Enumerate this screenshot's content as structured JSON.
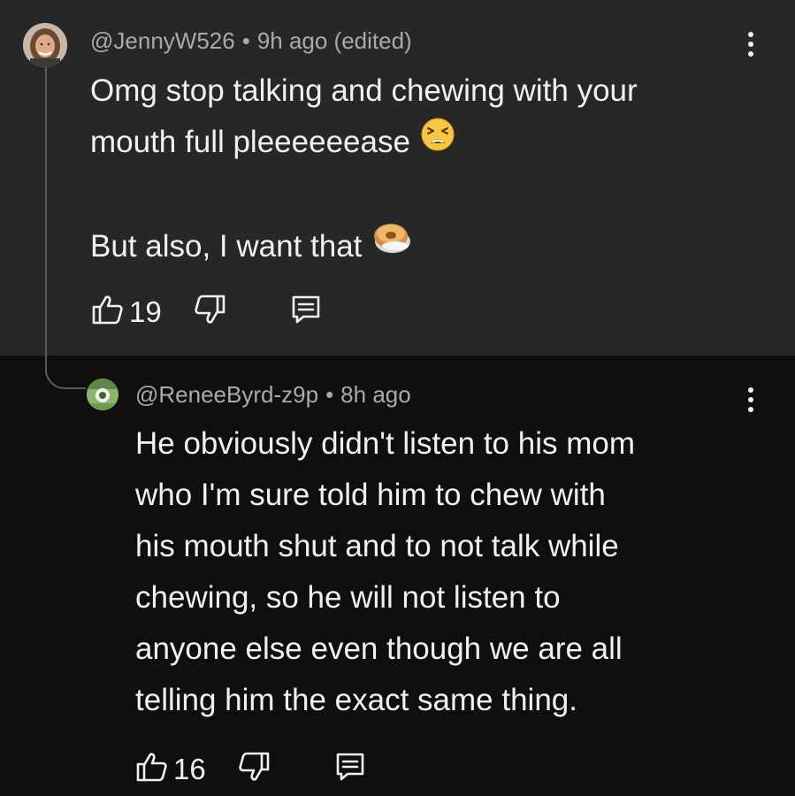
{
  "comments": [
    {
      "author": "@JennyW526",
      "separator": "•",
      "time": "9h ago (edited)",
      "lines": [
        "Omg stop talking and chewing with your",
        "mouth full pleeeeeease",
        "",
        "But also, I want that"
      ],
      "likes": "19",
      "emojis": [
        "tired-face",
        "bagel"
      ]
    },
    {
      "author": "@ReneeByrd-z9p",
      "separator": "•",
      "time": "8h ago",
      "lines": [
        "He obviously didn't listen to his mom",
        "who I'm sure told him to chew with",
        "his mouth shut and to not talk while",
        "chewing, so he will not listen to",
        "anyone else even though we are all",
        "telling him the exact same thing."
      ],
      "likes": "16"
    }
  ],
  "colors": {
    "highlight_bg": "#272727",
    "page_bg": "#0f0f0f",
    "meta_text": "#aaaaaa",
    "primary_text": "#f1f1f1"
  },
  "icons": [
    "thumb-up-icon",
    "thumb-down-icon",
    "reply-comment-icon",
    "more-vert-icon"
  ]
}
